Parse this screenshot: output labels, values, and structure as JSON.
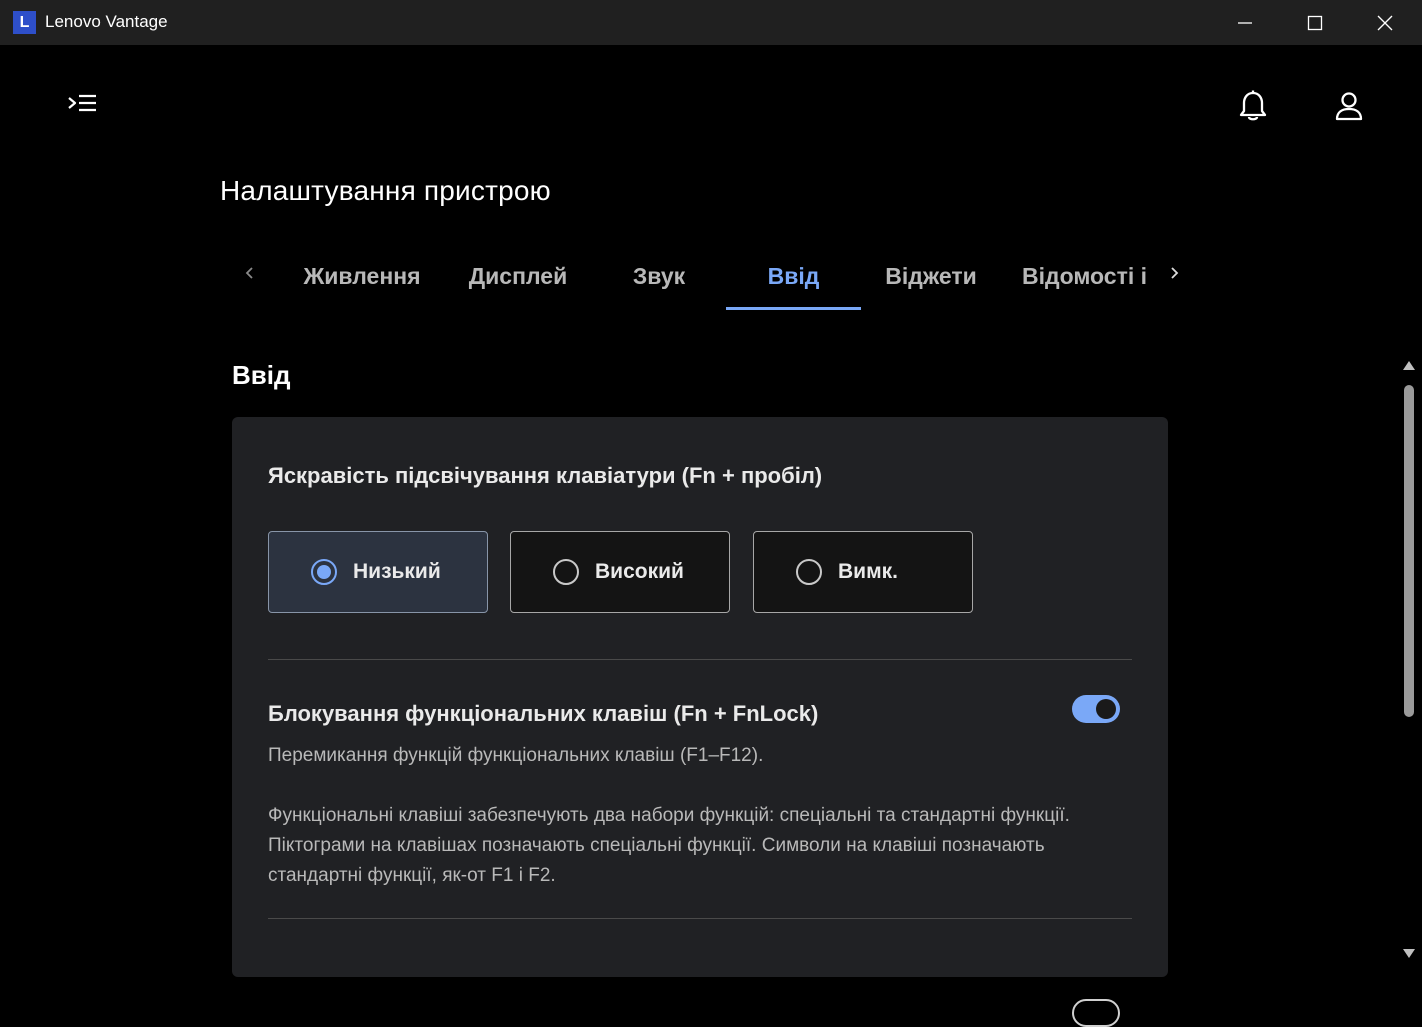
{
  "window": {
    "title": "Lenovo Vantage",
    "logo_letter": "L"
  },
  "header": {
    "page_title": "Налаштування пристрою"
  },
  "tabs": [
    {
      "label": "Живлення",
      "active": false
    },
    {
      "label": "Дисплей",
      "active": false
    },
    {
      "label": "Звук",
      "active": false
    },
    {
      "label": "Ввід",
      "active": true
    },
    {
      "label": "Віджети",
      "active": false
    },
    {
      "label": "Відомості і",
      "active": false
    }
  ],
  "section": {
    "title": "Ввід"
  },
  "backlight": {
    "title": "Яскравість підсвічування клавіатури (Fn + пробіл)",
    "options": [
      {
        "label": "Низький",
        "selected": true
      },
      {
        "label": "Високий",
        "selected": false
      },
      {
        "label": "Вимк.",
        "selected": false
      }
    ]
  },
  "fnlock": {
    "title": "Блокування функціональних клавіш (Fn + FnLock)",
    "enabled": true,
    "description1": "Перемикання функцій функціональних клавіш (F1–F12).",
    "description2": "Функціональні клавіші забезпечують два набори функцій: спеціальні та стандартні функції. Піктограми на клавішах позначають спеціальні функції. Символи на клавіші позначають стандартні функції, як-от F1 і F2."
  },
  "colors": {
    "accent": "#7aa8f7",
    "card_bg": "#202124",
    "titlebar_bg": "#202020"
  },
  "icons": [
    "menu-expand-icon",
    "bell-icon",
    "user-icon",
    "chevron-left-icon",
    "chevron-right-icon",
    "minimize-icon",
    "maximize-icon",
    "close-icon"
  ]
}
